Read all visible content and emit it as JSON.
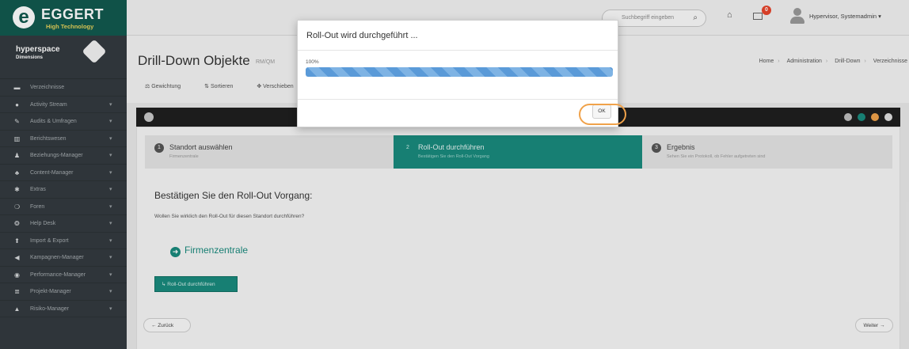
{
  "topbar": {
    "logo": {
      "name": "EGGERT",
      "sub": "High Technology"
    },
    "search": {
      "placeholder": "Suchbegriff eingeben"
    },
    "notifications_count": "0",
    "user": "Hypervisor, Systemadmin ▾"
  },
  "sidebar": {
    "brand": {
      "name": "hyperspace",
      "sub": "Dimensions"
    },
    "items": [
      {
        "label": "Verzeichnisse",
        "icon": "folder-icon",
        "glyph": "▬"
      },
      {
        "label": "Activity Stream",
        "icon": "info-icon",
        "glyph": "●"
      },
      {
        "label": "Audits & Umfragen",
        "icon": "edit-icon",
        "glyph": "✎"
      },
      {
        "label": "Berichtswesen",
        "icon": "chart-icon",
        "glyph": "▥"
      },
      {
        "label": "Beziehungs-Manager",
        "icon": "user-icon",
        "glyph": "♟"
      },
      {
        "label": "Content-Manager",
        "icon": "users-icon",
        "glyph": "♣"
      },
      {
        "label": "Extras",
        "icon": "star-icon",
        "glyph": "✱"
      },
      {
        "label": "Foren",
        "icon": "chat-icon",
        "glyph": "❍"
      },
      {
        "label": "Help Desk",
        "icon": "lifebuoy-icon",
        "glyph": "❂"
      },
      {
        "label": "Import & Export",
        "icon": "upload-icon",
        "glyph": "⬆"
      },
      {
        "label": "Kampagnen-Manager",
        "icon": "megaphone-icon",
        "glyph": "◀"
      },
      {
        "label": "Performance-Manager",
        "icon": "dashboard-icon",
        "glyph": "◉"
      },
      {
        "label": "Projekt-Manager",
        "icon": "list-icon",
        "glyph": "≣"
      },
      {
        "label": "Risiko-Manager",
        "icon": "warning-icon",
        "glyph": "▲"
      }
    ]
  },
  "header": {
    "title": "Drill-Down Objekte",
    "subtitle": "RM/QM",
    "breadcrumbs": [
      "Home",
      "Administration",
      "Drill-Down",
      "Verzeichnisse"
    ],
    "toolbar": [
      "Gewichtung",
      "Sortieren",
      "Verschieben"
    ]
  },
  "wizard": {
    "steps": [
      {
        "num": "1",
        "title": "Standort auswählen",
        "desc": "Firmenzentrale"
      },
      {
        "num": "2",
        "title": "Roll-Out durchführen",
        "desc": "Bestätigen Sie den Roll-Out Vorgang"
      },
      {
        "num": "3",
        "title": "Ergebnis",
        "desc": "Sehen Sie ein Protokoll, ob Fehler aufgetreten sind"
      }
    ],
    "confirm_title": "Bestätigen Sie den Roll-Out Vorgang:",
    "confirm_text": "Wollen Sie wirklich den Roll-Out für diesen Standort durchführen?",
    "site": "Firmenzentrale",
    "rollout_button": "↳ Roll-Out durchführen",
    "back_button": "← Zurück",
    "next_button": "Weiter →"
  },
  "modal": {
    "title": "Roll-Out wird durchgeführt ...",
    "progress_label": "100%",
    "progress": 100,
    "ok": "OK"
  },
  "colors": {
    "brand": "#12594f",
    "accent": "#1a8a7d",
    "highlight": "#f0a24a",
    "progress": "#5a9ad8"
  }
}
